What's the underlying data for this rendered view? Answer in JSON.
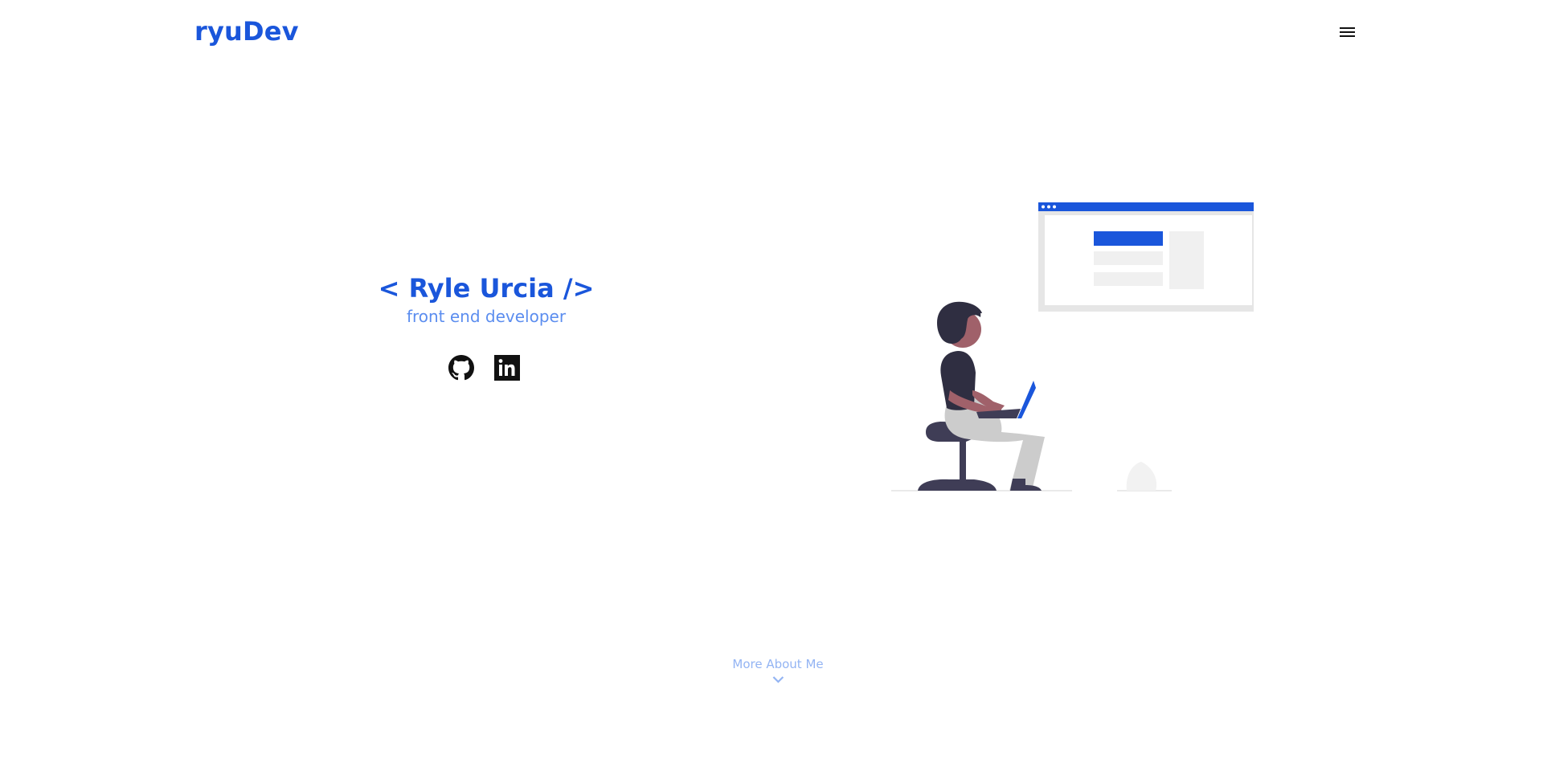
{
  "header": {
    "brand": "ryuDev",
    "menu_icon": "hamburger-menu-icon"
  },
  "hero": {
    "title": "< Ryle Urcia />",
    "subtitle": "front end developer",
    "social": [
      {
        "icon": "github-icon"
      },
      {
        "icon": "linkedin-icon"
      }
    ]
  },
  "footer": {
    "more_label": "More About Me",
    "more_icon": "chevron-down-icon"
  },
  "colors": {
    "brand": "#1a56db",
    "subtitle": "#5b8def",
    "more_link": "#93b4f3"
  }
}
